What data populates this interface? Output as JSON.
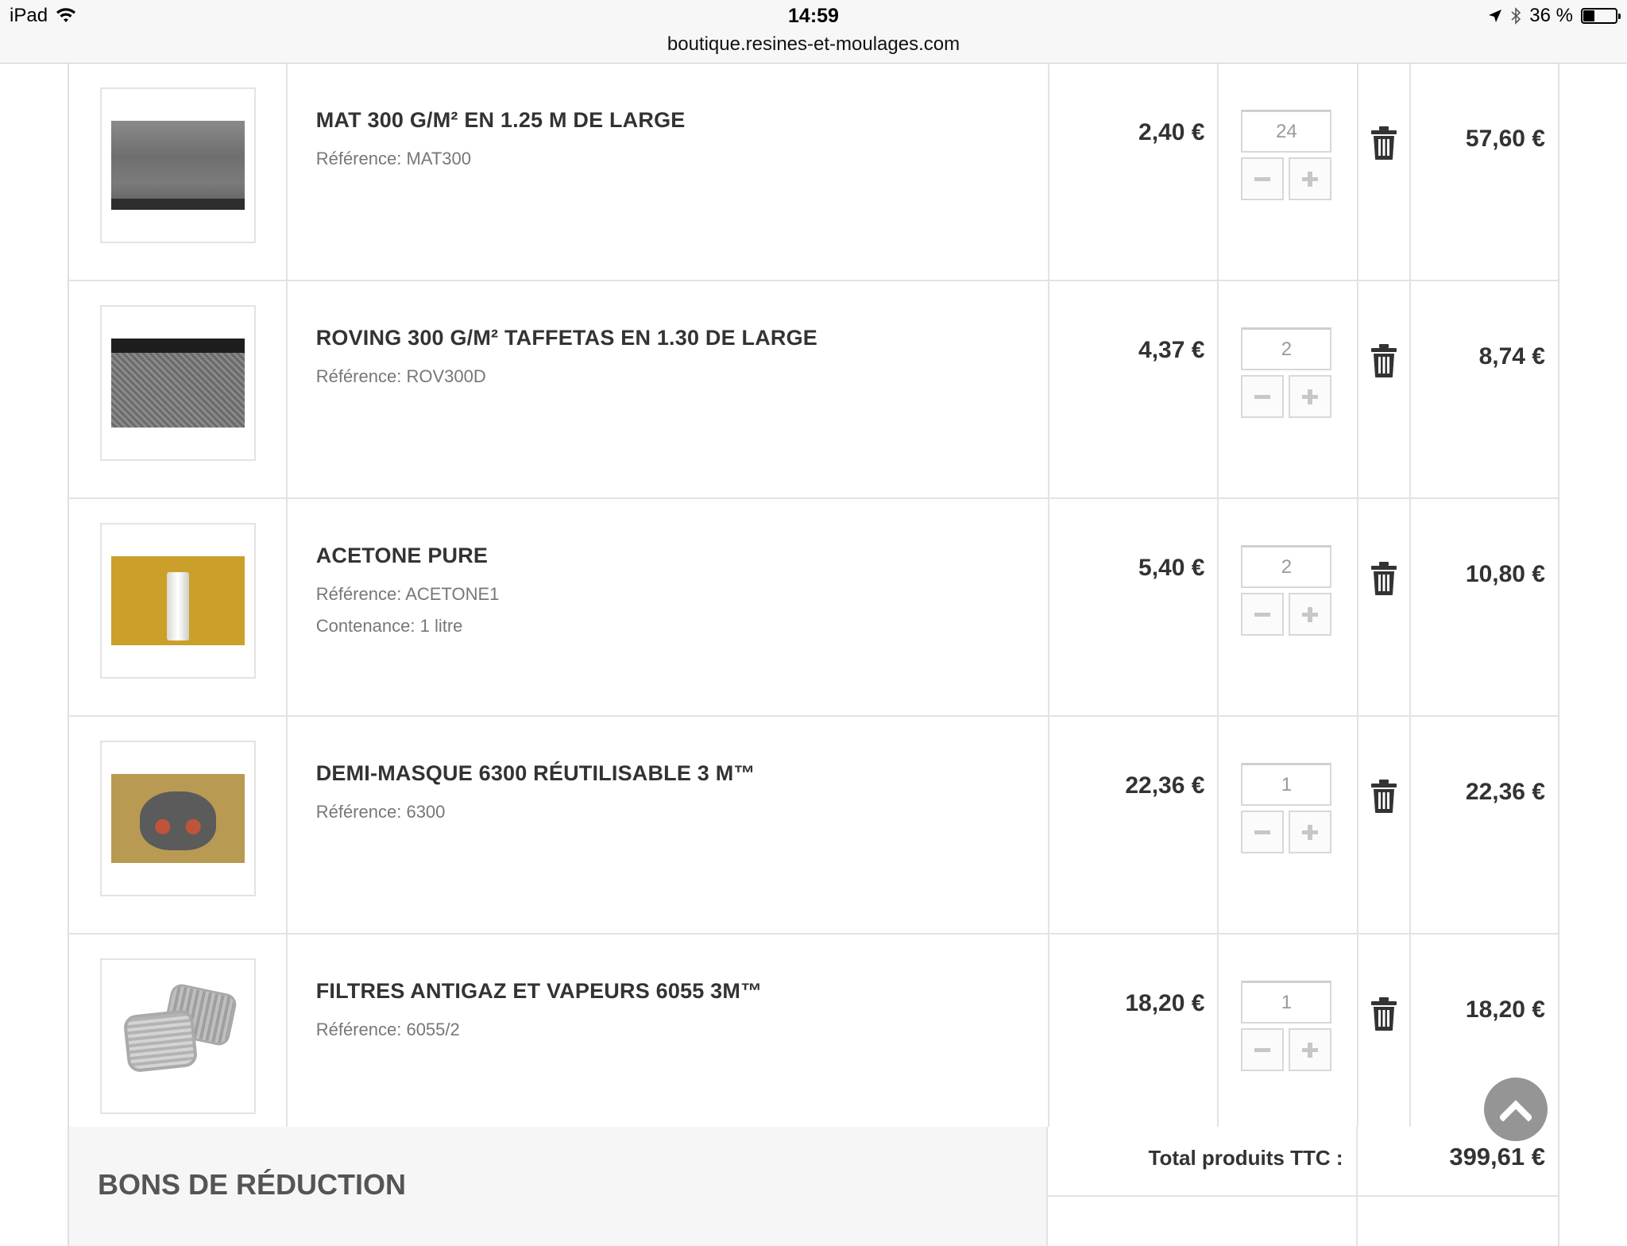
{
  "status_bar": {
    "device": "iPad",
    "time": "14:59",
    "url": "boutique.resines-et-moulages.com",
    "battery": "36 %",
    "battery_level": 0.36
  },
  "cart": {
    "items": [
      {
        "title": "MAT 300 G/M² EN 1.25 M DE LARGE",
        "ref_label": "Référence:",
        "ref": "MAT300",
        "extra_label": "",
        "extra": "",
        "unit_price": "2,40 €",
        "quantity": "24",
        "total": "57,60 €"
      },
      {
        "title": "ROVING 300 G/M² TAFFETAS EN 1.30 DE LARGE",
        "ref_label": "Référence:",
        "ref": "ROV300D",
        "extra_label": "",
        "extra": "",
        "unit_price": "4,37 €",
        "quantity": "2",
        "total": "8,74 €"
      },
      {
        "title": "ACETONE PURE",
        "ref_label": "Référence:",
        "ref": "ACETONE1",
        "extra_label": "Contenance:",
        "extra": "1 litre",
        "unit_price": "5,40 €",
        "quantity": "2",
        "total": "10,80 €"
      },
      {
        "title": "DEMI-MASQUE 6300 RÉUTILISABLE 3 M™",
        "ref_label": "Référence:",
        "ref": "6300",
        "extra_label": "",
        "extra": "",
        "unit_price": "22,36 €",
        "quantity": "1",
        "total": "22,36 €"
      },
      {
        "title": "FILTRES ANTIGAZ ET VAPEURS 6055 3M™",
        "ref_label": "Référence:",
        "ref": "6055/2",
        "extra_label": "",
        "extra": "",
        "unit_price": "18,20 €",
        "quantity": "1",
        "total": "18,20 €"
      }
    ],
    "vouchers_title": "BONS DE RÉDUCTION",
    "total_products_label": "Total produits TTC :",
    "total_products_value": "399,61 €"
  },
  "icons": {
    "trash": "trash-icon",
    "minus": "minus-icon",
    "plus": "plus-icon",
    "scroll_top": "chevron-up-icon"
  },
  "colors": {
    "text": "#333333",
    "muted": "#777777",
    "border": "#e3e3e3",
    "scroll_button": "#8d8d8d"
  }
}
